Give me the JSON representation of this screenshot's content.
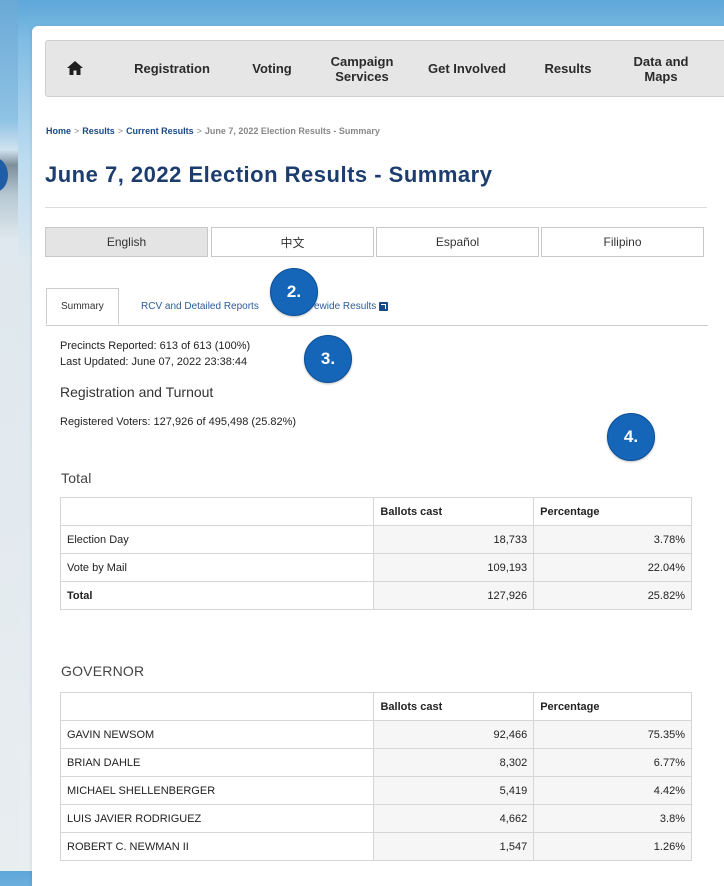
{
  "nav": {
    "items": [
      "Registration",
      "Voting",
      "Campaign Services",
      "Get Involved",
      "Results",
      "Data and Maps"
    ]
  },
  "breadcrumb": {
    "items": [
      "Home",
      "Results",
      "Current Results"
    ],
    "current": "June 7, 2022 Election Results - Summary",
    "separator": ">"
  },
  "page": {
    "title": "June 7, 2022 Election Results - Summary"
  },
  "languages": [
    "English",
    "中文",
    "Español",
    "Filipino"
  ],
  "tabs": {
    "summary": "Summary",
    "rcv": "RCV and Detailed Reports",
    "statewide": "Statewide Results",
    "statewide_visible": "ewide Results"
  },
  "badges": [
    "2.",
    "3.",
    "4."
  ],
  "status": {
    "precincts": "Precincts Reported: 613 of 613 (100%)",
    "last_updated": "Last Updated: June 07, 2022 23:38:44"
  },
  "registration": {
    "heading": "Registration and Turnout",
    "registered": "Registered Voters: 127,926 of 495,498 (25.82%)"
  },
  "total_table": {
    "title": "Total",
    "headers": [
      "",
      "Ballots cast",
      "Percentage"
    ],
    "rows": [
      [
        "Election Day",
        "18,733",
        "3.78%"
      ],
      [
        "Vote by Mail",
        "109,193",
        "22.04%"
      ],
      [
        "Total",
        "127,926",
        "25.82%"
      ]
    ]
  },
  "governor_table": {
    "title": "GOVERNOR",
    "headers": [
      "",
      "Ballots cast",
      "Percentage"
    ],
    "rows": [
      [
        "GAVIN NEWSOM",
        "92,466",
        "75.35%"
      ],
      [
        "BRIAN DAHLE",
        "8,302",
        "6.77%"
      ],
      [
        "MICHAEL SHELLENBERGER",
        "5,419",
        "4.42%"
      ],
      [
        "LUIS JAVIER RODRIGUEZ",
        "4,662",
        "3.8%"
      ],
      [
        "ROBERT C. NEWMAN II",
        "1,547",
        "1.26%"
      ]
    ]
  },
  "colors": {
    "brand_blue": "#1c3d6e",
    "link_blue": "#1a4a86",
    "badge_blue": "#1565b8"
  }
}
